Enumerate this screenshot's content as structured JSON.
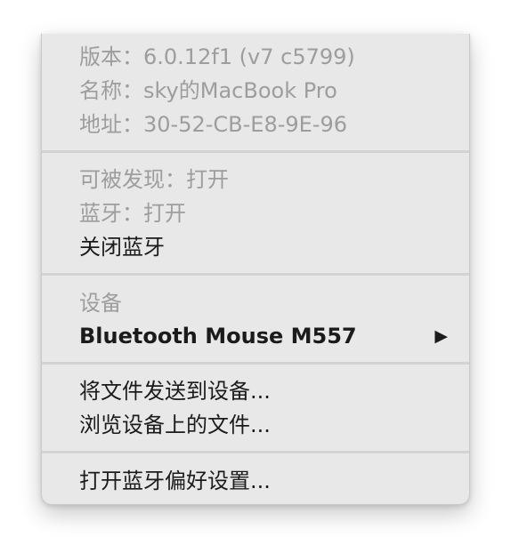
{
  "menu": {
    "info": {
      "version": "版本：6.0.12f1 (v7 c5799)",
      "name": "名称：sky的MacBook Pro",
      "address": "地址：30-52-CB-E8-9E-96"
    },
    "status": {
      "discoverable": "可被发现：打开",
      "bluetooth": "蓝牙：打开",
      "turn_off": "关闭蓝牙"
    },
    "devices": {
      "header": "设备",
      "device_name": "Bluetooth Mouse M557",
      "submenu_icon": "triangle-right-icon"
    },
    "files": {
      "send": "将文件发送到设备...",
      "browse": "浏览设备上的文件..."
    },
    "prefs": {
      "open_prefs": "打开蓝牙偏好设置..."
    }
  }
}
